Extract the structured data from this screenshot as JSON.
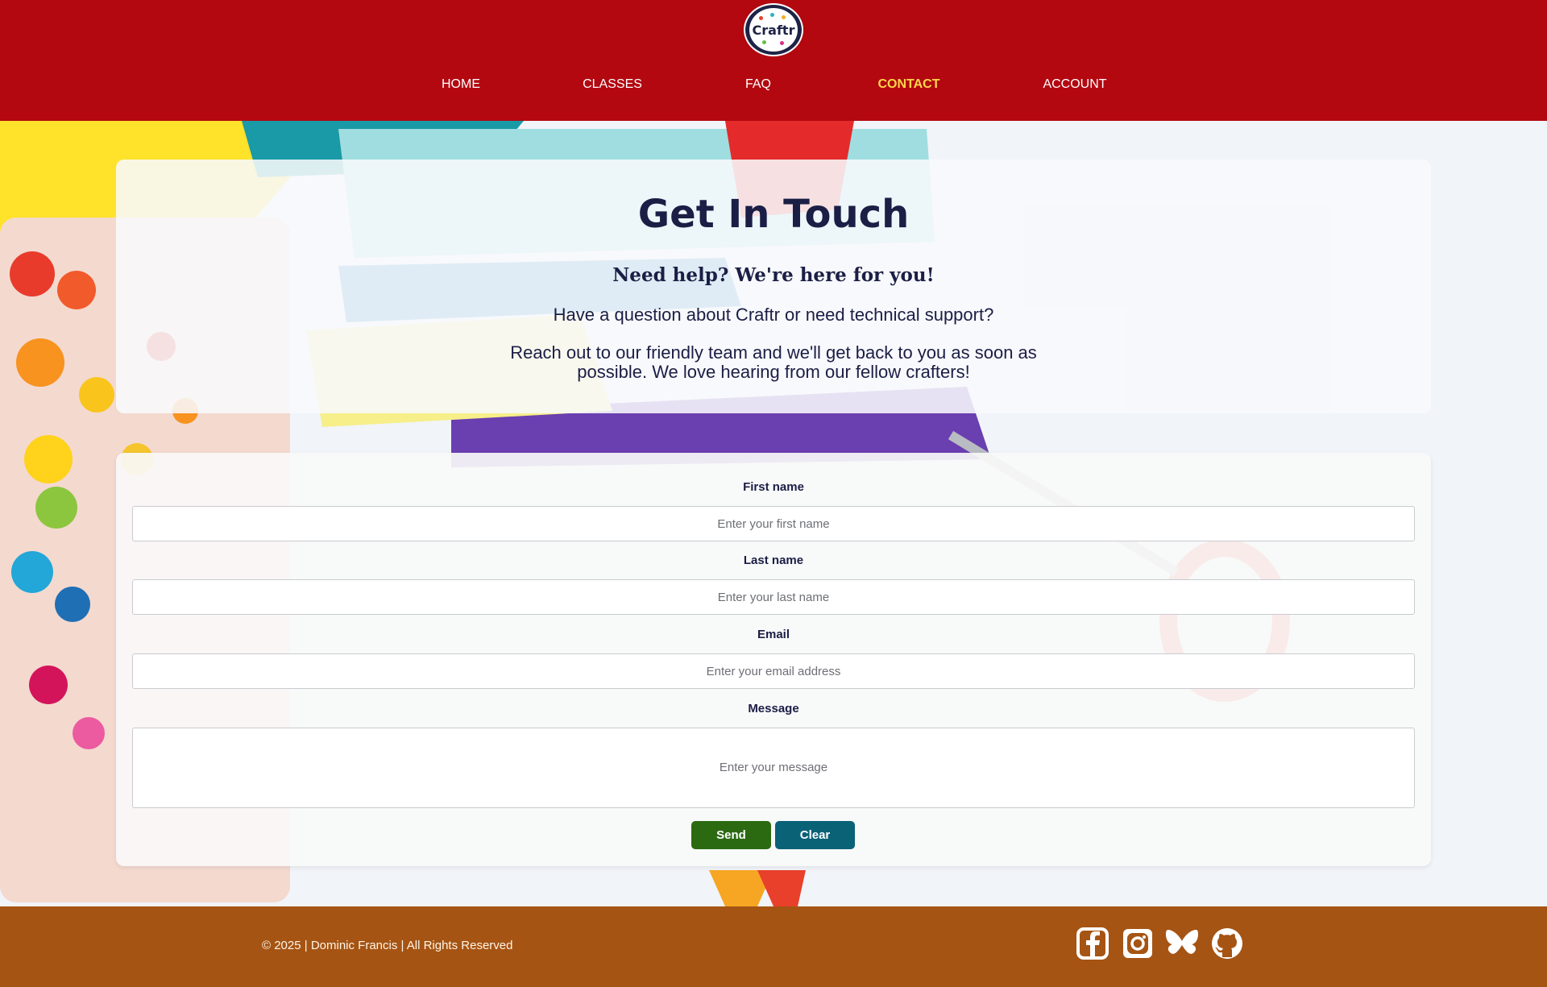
{
  "header": {
    "logo_text": "Craftr",
    "nav": [
      {
        "label": "HOME",
        "active": false
      },
      {
        "label": "CLASSES",
        "active": false
      },
      {
        "label": "FAQ",
        "active": false
      },
      {
        "label": "CONTACT",
        "active": true
      },
      {
        "label": "ACCOUNT",
        "active": false
      }
    ]
  },
  "intro": {
    "title": "Get In Touch",
    "subtitle": "Need help? We're here for you!",
    "line1": "Have a question about Craftr or need technical support?",
    "line2": "Reach out to our friendly team and we'll get back to you as soon as possible. We love hearing from our fellow crafters!"
  },
  "form": {
    "first_name": {
      "label": "First name",
      "placeholder": "Enter your first name",
      "value": ""
    },
    "last_name": {
      "label": "Last name",
      "placeholder": "Enter your last name",
      "value": ""
    },
    "email": {
      "label": "Email",
      "placeholder": "Enter your email address",
      "value": ""
    },
    "message": {
      "label": "Message",
      "placeholder": "Enter your message",
      "value": ""
    },
    "send_label": "Send",
    "clear_label": "Clear"
  },
  "footer": {
    "copyright": "© 2025 | Dominic Francis | All Rights Reserved",
    "social": [
      "facebook-icon",
      "instagram-icon",
      "bluesky-icon",
      "github-icon"
    ]
  },
  "colors": {
    "header_bg": "#b30810",
    "nav_active": "#ffd54a",
    "heading": "#1b1e45",
    "send_button": "#2c6a12",
    "clear_button": "#0a6277",
    "footer_bg": "#a55414"
  }
}
